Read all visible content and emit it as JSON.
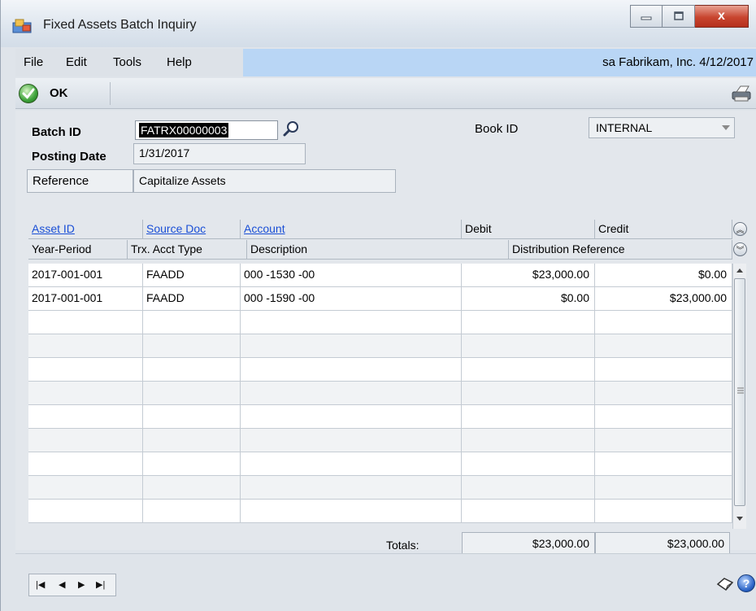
{
  "window": {
    "title": "Fixed Assets Batch Inquiry",
    "buttons": {
      "minimize": "—",
      "maximize": "□",
      "close": "x"
    }
  },
  "menubar": {
    "items": [
      "File",
      "Edit",
      "Tools",
      "Help"
    ],
    "status": "sa  Fabrikam, Inc.  4/12/2017",
    "status_color": "#b9d6f5"
  },
  "toolbar": {
    "ok_label": "OK"
  },
  "header": {
    "batch_id_label": "Batch ID",
    "batch_id_value": "FATRX00000003",
    "posting_date_label": "Posting Date",
    "posting_date_value": "1/31/2017",
    "reference_label": "Reference",
    "reference_value": "Capitalize Assets",
    "book_id_label": "Book ID",
    "book_id_value": "INTERNAL"
  },
  "grid": {
    "headers_row1": [
      "Asset ID",
      "Source Doc",
      "Account",
      "Debit",
      "Credit"
    ],
    "headers_row2": [
      "Year-Period",
      "Trx. Acct Type",
      "Description",
      "Distribution Reference"
    ],
    "rows": [
      {
        "year_period": "2017-001-001",
        "acct_type": "FAADD",
        "account": "000 -1530 -00",
        "debit": "$23,000.00",
        "credit": "$0.00"
      },
      {
        "year_period": "2017-001-001",
        "acct_type": "FAADD",
        "account": "000 -1590 -00",
        "debit": "$0.00",
        "credit": "$23,000.00"
      }
    ],
    "totals_label": "Totals:",
    "total_debit": "$23,000.00",
    "total_credit": "$23,000.00"
  },
  "nav": {
    "first": "|◀",
    "prev": "◀",
    "next": "▶",
    "last": "▶|"
  },
  "help": {
    "label": "?"
  }
}
